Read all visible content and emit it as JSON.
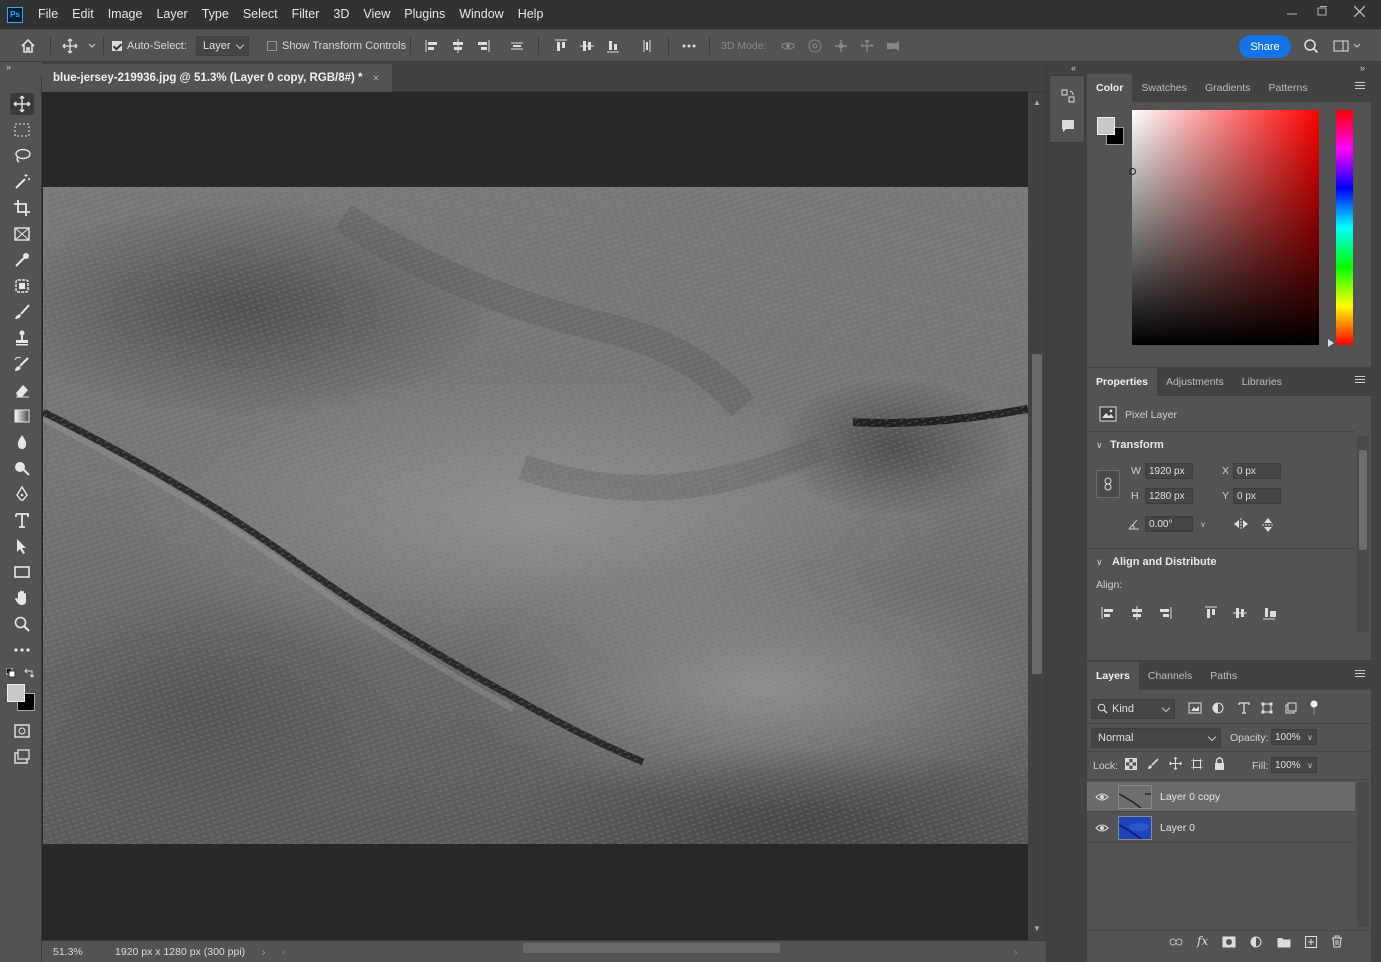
{
  "app": {
    "logo": "Ps"
  },
  "menu": [
    "File",
    "Edit",
    "Image",
    "Layer",
    "Type",
    "Select",
    "Filter",
    "3D",
    "View",
    "Plugins",
    "Window",
    "Help"
  ],
  "options": {
    "auto_select_label": "Auto-Select:",
    "auto_select_value": "Layer",
    "show_transform_label": "Show Transform Controls",
    "mode_3d_label": "3D Mode:",
    "share_label": "Share"
  },
  "document": {
    "tab_title": "blue-jersey-219936.jpg @ 51.3% (Layer 0 copy, RGB/8#) *",
    "close_glyph": "×",
    "zoom": "51.3%",
    "doc_info": "1920 px x 1280 px (300 ppi)"
  },
  "color_panel": {
    "tabs": [
      "Color",
      "Swatches",
      "Gradients",
      "Patterns"
    ],
    "foreground": "#c8c8c8",
    "background": "#000000",
    "hue_color": "#ff0000"
  },
  "properties_panel": {
    "tabs": [
      "Properties",
      "Adjustments",
      "Libraries"
    ],
    "kind_label": "Pixel Layer",
    "transform_title": "Transform",
    "w_label": "W",
    "w_value": "1920 px",
    "h_label": "H",
    "h_value": "1280 px",
    "x_label": "X",
    "x_value": "0 px",
    "y_label": "Y",
    "y_value": "0 px",
    "angle_value": "0.00°",
    "align_title": "Align and Distribute",
    "align_label": "Align:"
  },
  "layers_panel": {
    "tabs": [
      "Layers",
      "Channels",
      "Paths"
    ],
    "filter_kind": "Kind",
    "blend_mode": "Normal",
    "opacity_label": "Opacity:",
    "opacity_value": "100%",
    "lock_label": "Lock:",
    "fill_label": "Fill:",
    "fill_value": "100%",
    "layers": [
      {
        "name": "Layer 0 copy",
        "selected": true
      },
      {
        "name": "Layer 0",
        "selected": false
      }
    ]
  },
  "colors": {
    "accent": "#1473e6",
    "ui_bg": "#535353",
    "dark_bg": "#282828"
  }
}
